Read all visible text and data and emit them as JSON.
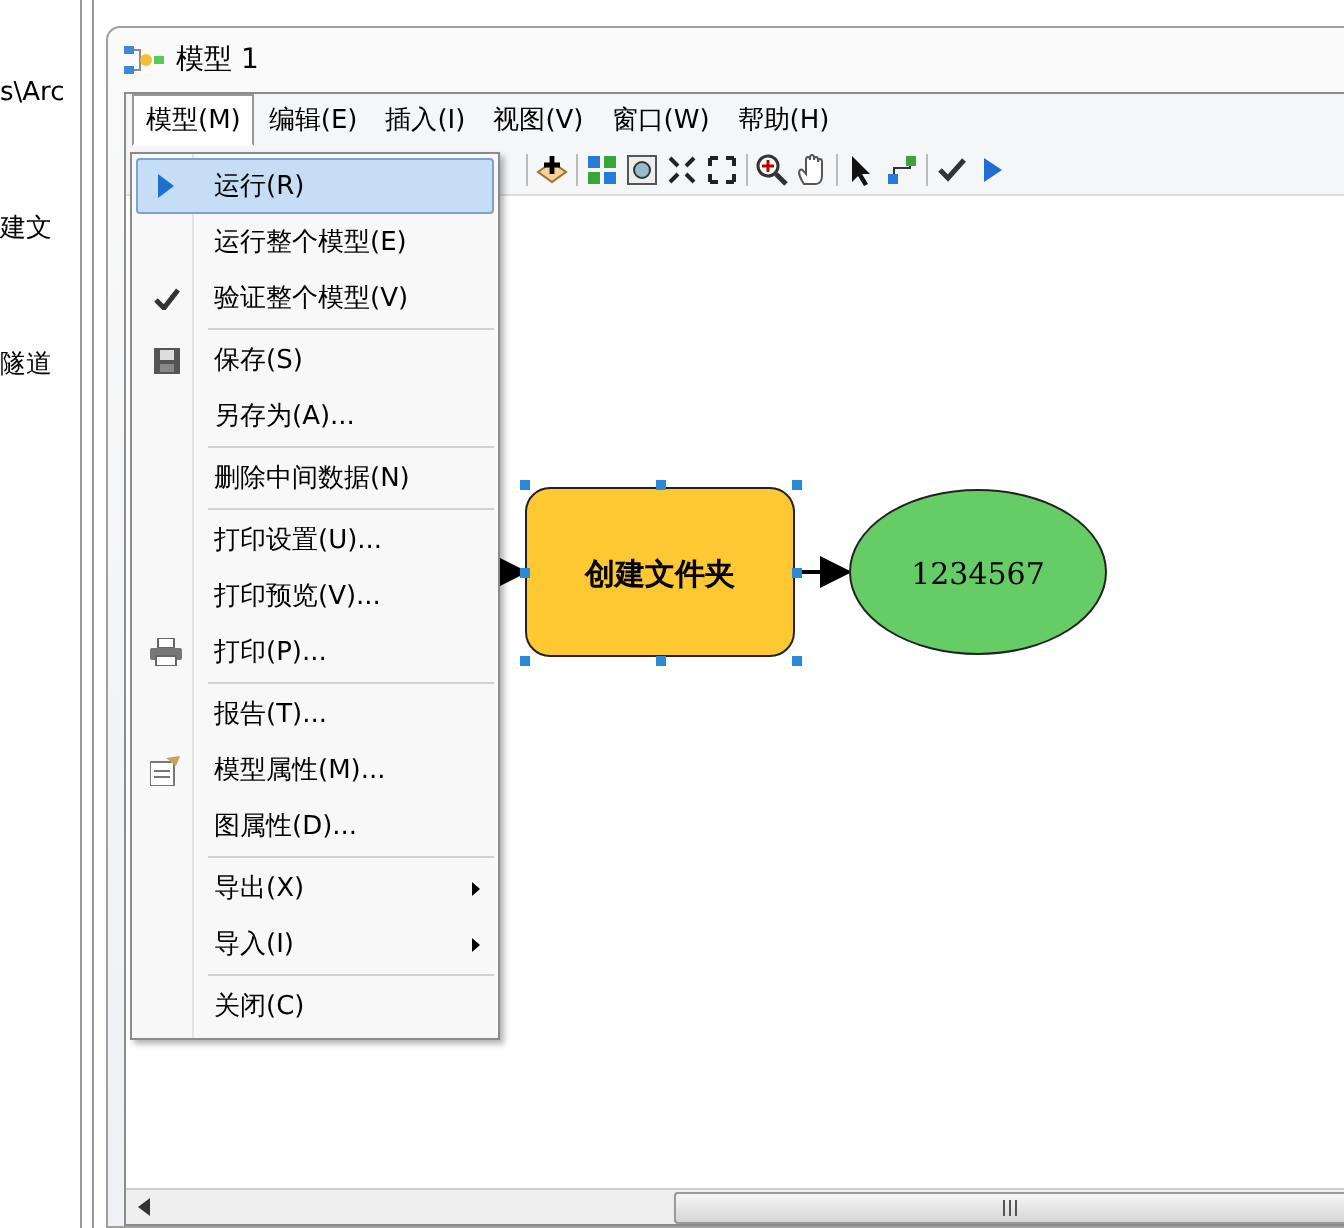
{
  "left_panel": {
    "lines": [
      "s\\Arc",
      "建文",
      "隧道"
    ]
  },
  "window": {
    "title": "模型 1"
  },
  "menubar": [
    {
      "label": "模型(M)",
      "selected": true
    },
    {
      "label": "编辑(E)",
      "selected": false
    },
    {
      "label": "插入(I)",
      "selected": false
    },
    {
      "label": "视图(V)",
      "selected": false
    },
    {
      "label": "窗口(W)",
      "selected": false
    },
    {
      "label": "帮助(H)",
      "selected": false
    }
  ],
  "menu": {
    "items": [
      {
        "kind": "item",
        "label": "运行(R)",
        "selected": true,
        "submenu": false
      },
      {
        "kind": "item",
        "label": "运行整个模型(E)",
        "selected": false,
        "submenu": false
      },
      {
        "kind": "item",
        "label": "验证整个模型(V)",
        "selected": false,
        "submenu": false
      },
      {
        "kind": "separator"
      },
      {
        "kind": "item",
        "label": "保存(S)",
        "selected": false,
        "submenu": false
      },
      {
        "kind": "item",
        "label": "另存为(A)...",
        "selected": false,
        "submenu": false
      },
      {
        "kind": "separator"
      },
      {
        "kind": "item",
        "label": "删除中间数据(N)",
        "selected": false,
        "submenu": false
      },
      {
        "kind": "separator"
      },
      {
        "kind": "item",
        "label": "打印设置(U)...",
        "selected": false,
        "submenu": false
      },
      {
        "kind": "item",
        "label": "打印预览(V)...",
        "selected": false,
        "submenu": false
      },
      {
        "kind": "item",
        "label": "打印(P)...",
        "selected": false,
        "submenu": false
      },
      {
        "kind": "separator"
      },
      {
        "kind": "item",
        "label": "报告(T)...",
        "selected": false,
        "submenu": false
      },
      {
        "kind": "item",
        "label": "模型属性(M)...",
        "selected": false,
        "submenu": false
      },
      {
        "kind": "item",
        "label": "图属性(D)...",
        "selected": false,
        "submenu": false
      },
      {
        "kind": "separator"
      },
      {
        "kind": "item",
        "label": "导出(X)",
        "selected": false,
        "submenu": true
      },
      {
        "kind": "item",
        "label": "导入(I)",
        "selected": false,
        "submenu": true
      },
      {
        "kind": "separator"
      },
      {
        "kind": "item",
        "label": "关闭(C)",
        "selected": false,
        "submenu": false
      }
    ]
  },
  "diagram": {
    "nodes": [
      {
        "kind": "tool",
        "label": "创建文件夹",
        "color": "#fec832",
        "selected": true
      },
      {
        "kind": "output",
        "label": "1234567",
        "color": "#66cc66",
        "selected": false
      }
    ]
  }
}
